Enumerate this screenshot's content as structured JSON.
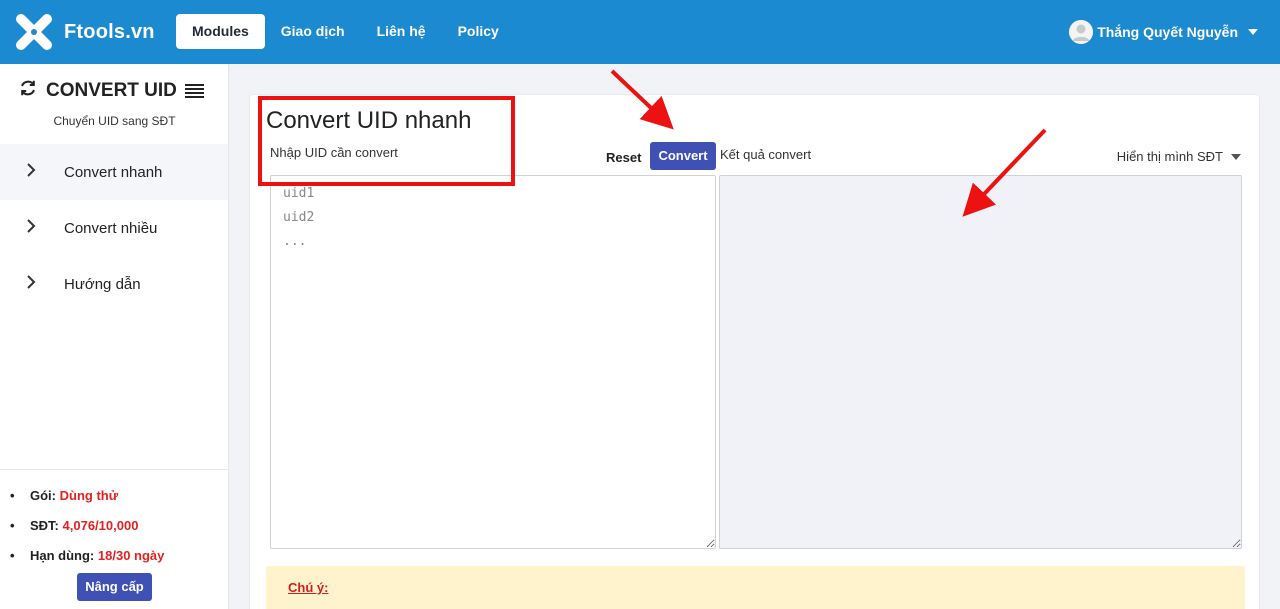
{
  "brand": {
    "name": "Ftools.vn",
    "logo_icon": "x-logo-icon"
  },
  "nav": {
    "items": [
      {
        "label": "Modules",
        "active": true
      },
      {
        "label": "Giao dịch",
        "active": false
      },
      {
        "label": "Liên hệ",
        "active": false
      },
      {
        "label": "Policy",
        "active": false
      }
    ]
  },
  "user": {
    "name": "Thắng Quyết Nguyễn",
    "avatar_icon": "user-avatar-icon"
  },
  "sidebar": {
    "title": "CONVERT UID",
    "subtitle": "Chuyển UID sang SĐT",
    "items": [
      {
        "label": "Convert nhanh",
        "active": true
      },
      {
        "label": "Convert nhiều",
        "active": false
      },
      {
        "label": "Hướng dẫn",
        "active": false
      }
    ],
    "stats": [
      {
        "label": "Gói:",
        "value": "Dùng thử"
      },
      {
        "label": "SĐT:",
        "value": "4,076/10,000"
      },
      {
        "label": "Hạn dùng:",
        "value": "18/30 ngày"
      }
    ],
    "upgrade_label": "Nâng cấp"
  },
  "main": {
    "title": "Convert UID nhanh",
    "input_label": "Nhập UID cần convert",
    "input_placeholder": "uid1\nuid2\n...",
    "input_value": "",
    "reset_label": "Reset",
    "convert_label": "Convert",
    "result_label": "Kết quả convert",
    "result_value": "",
    "display_option": "Hiển thị mình SĐT",
    "note_title": "Chú ý:"
  },
  "colors": {
    "topbar": "#1b8ad0",
    "primary_button": "#3f51b5",
    "accent_red": "#e51f1f",
    "annotation": "#ee1111",
    "note_background": "#fff3cd"
  }
}
